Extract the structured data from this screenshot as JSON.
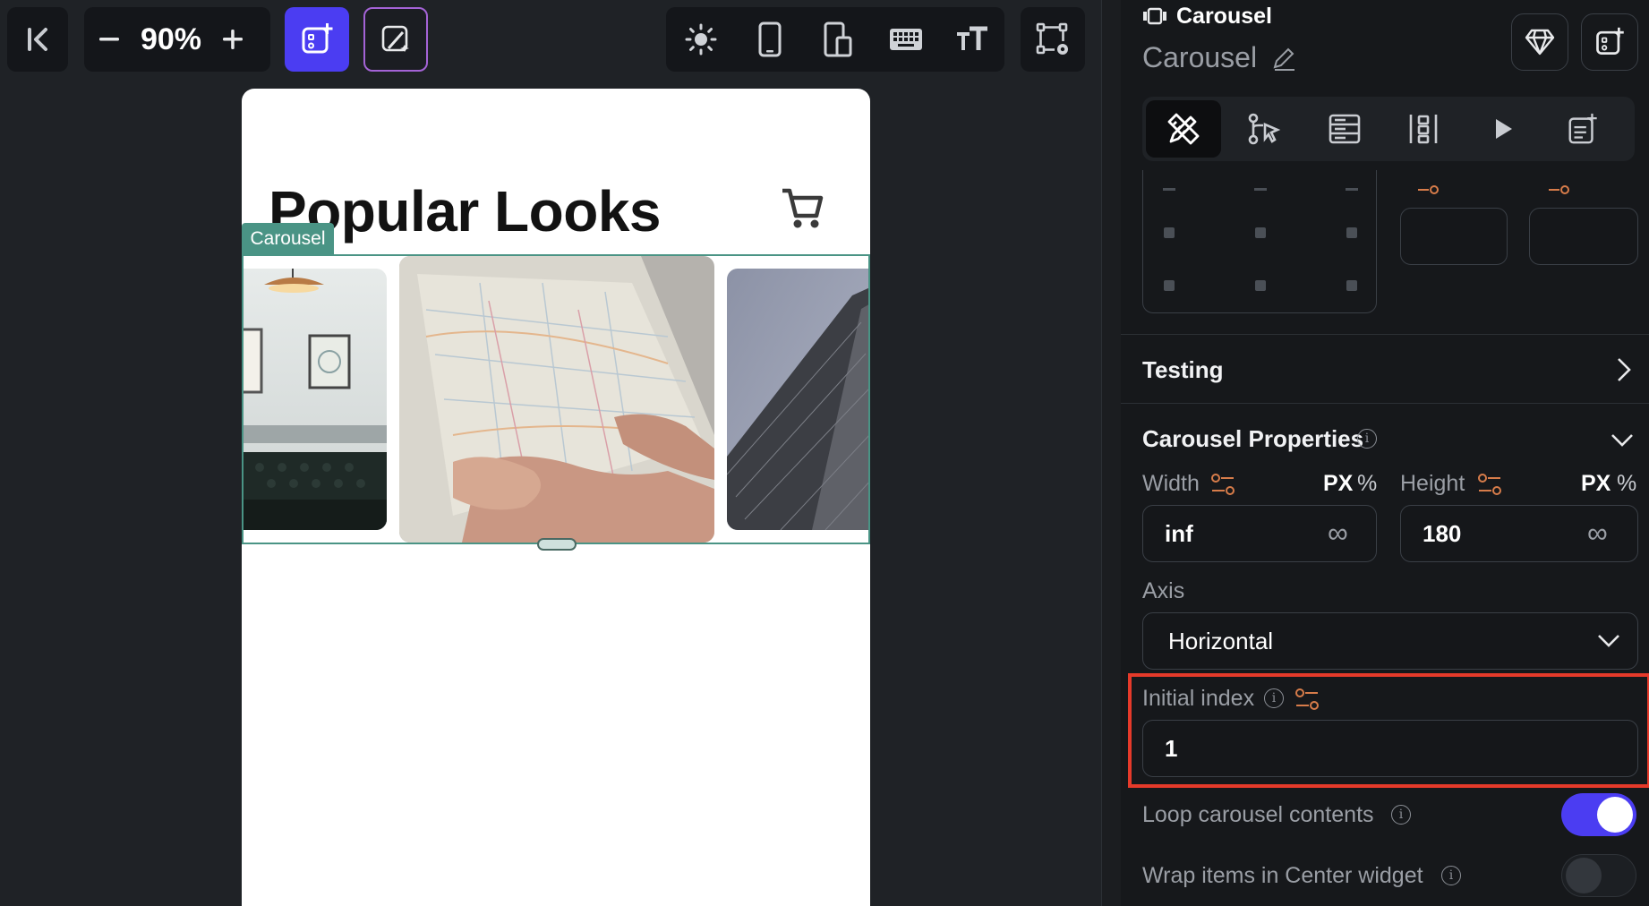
{
  "toolbar": {
    "zoom": "90%"
  },
  "phone": {
    "title": "Popular Looks"
  },
  "carousel": {
    "tag": "Carousel"
  },
  "panel": {
    "widget_type": "Carousel",
    "widget_name": "Carousel",
    "testing_label": "Testing",
    "section_title": "Carousel Properties",
    "width_label": "Width",
    "width_value": "inf",
    "width_unit_px": "PX",
    "width_unit_pct": "%",
    "height_label": "Height",
    "height_value": "180",
    "height_unit_px": "PX",
    "height_unit_pct": "%",
    "axis_label": "Axis",
    "axis_value": "Horizontal",
    "initial_index_label": "Initial index",
    "initial_index_value": "1",
    "loop_label": "Loop carousel contents",
    "loop_on": true,
    "wrap_label": "Wrap items in Center widget",
    "wrap_on": false,
    "infinity": "∞"
  },
  "colors": {
    "accent": "#4b3df2",
    "carousel_outline": "#4a9485",
    "highlight": "#e53a2a",
    "toggle_on": "#4b3df2"
  }
}
